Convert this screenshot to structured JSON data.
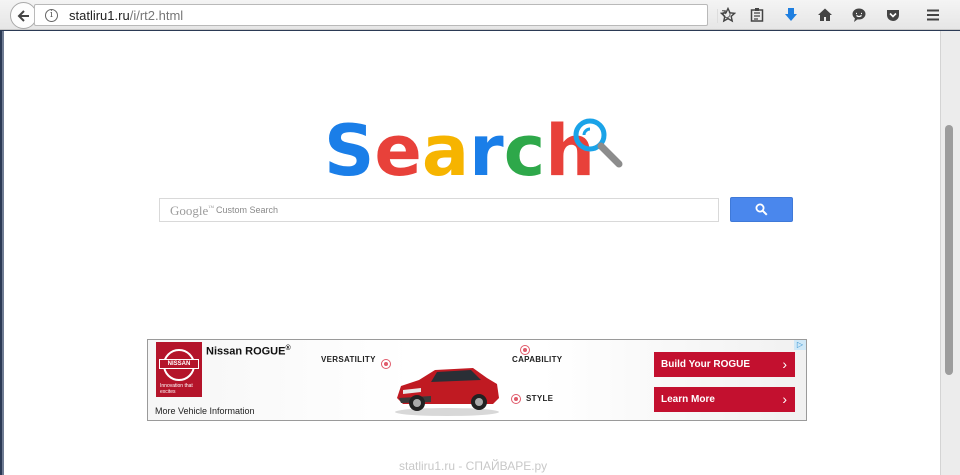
{
  "browser": {
    "url_domain": "statliru1.ru",
    "url_path": "/i/rt2.html",
    "info_glyph": "i",
    "reload_glyph": "↻",
    "icons": [
      "star-icon",
      "reading-list-icon",
      "download-icon",
      "home-icon",
      "chat-icon",
      "pocket-icon",
      "menu-icon"
    ]
  },
  "logo": {
    "letters": [
      "S",
      "e",
      "a",
      "r",
      "c",
      "h"
    ],
    "colors": [
      "#1a7ee8",
      "#e8413a",
      "#f6b400",
      "#1a7ee8",
      "#2ea84a",
      "#e8413a"
    ],
    "magnifier_color": "#1aa3e8"
  },
  "search": {
    "brand": "Google",
    "brand_mark": "™",
    "placeholder": "Custom Search",
    "button_color": "#4a87ed"
  },
  "ad": {
    "brand_logo_text": "NISSAN",
    "brand_tagline": "Innovation that excites",
    "title": "Nissan ROGUE",
    "title_mark": "®",
    "more_link": "More Vehicle Information",
    "features": {
      "versatility": "VERSATILITY",
      "capability": "CAPABILITY",
      "style": "STYLE"
    },
    "buttons": {
      "build": "Build Your ROGUE",
      "learn": "Learn More",
      "chevron": "›"
    },
    "adchoices_glyph": "▷",
    "accent_color": "#c3102f"
  },
  "footer": {
    "text": "statliru1.ru - СПАЙВАРЕ.ру"
  }
}
